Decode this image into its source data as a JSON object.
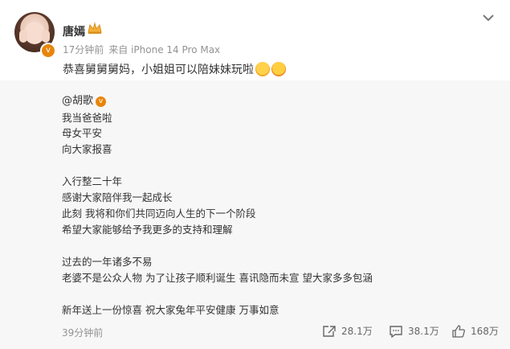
{
  "header": {
    "author_name": "唐嫣",
    "time": "17分钟前",
    "source": "来自 iPhone 14 Pro Max",
    "text": "恭喜舅舅舅妈，小姐姐可以陪妹妹玩啦"
  },
  "repost": {
    "mention": "@胡歌",
    "lines": [
      "我当爸爸啦",
      "母女平安",
      "向大家报喜",
      "",
      "入行整二十年",
      "感谢大家陪伴我一起成长",
      "此刻 我将和你们共同迈向人生的下一个阶段",
      "希望大家能够给予我更多的支持和理解",
      "",
      "过去的一年诸多不易",
      "老婆不是公众人物 为了让孩子顺利诞生 喜讯隐而未宣 望大家多多包涵",
      "",
      "新年送上一份惊喜 祝大家兔年平安健康 万事如意"
    ],
    "time": "39分钟前",
    "reposts": "28.1万",
    "comments": "38.1万",
    "likes": "168万"
  },
  "icons": {
    "verified": "verified-badge-icon",
    "crown": "crown-icon",
    "menu": "chevron-down-icon",
    "repost": "repost-icon",
    "comment": "comment-icon",
    "like": "like-icon"
  },
  "colors": {
    "accent_orange": "#e8850c",
    "muted_text": "#939393",
    "repost_bg": "#f7f7f7"
  }
}
